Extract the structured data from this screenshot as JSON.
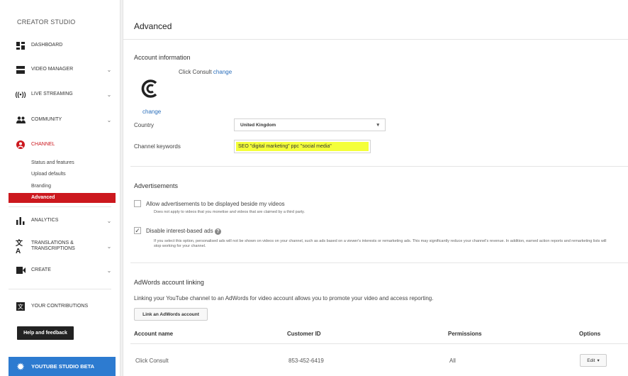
{
  "sidebar": {
    "brand": "CREATOR STUDIO",
    "items": [
      {
        "label": "DASHBOARD",
        "icon": "dashboard-icon"
      },
      {
        "label": "VIDEO MANAGER",
        "icon": "video-manager-icon"
      },
      {
        "label": "LIVE STREAMING",
        "icon": "live-streaming-icon"
      },
      {
        "label": "COMMUNITY",
        "icon": "community-icon"
      },
      {
        "label": "CHANNEL",
        "icon": "channel-icon"
      },
      {
        "label": "ANALYTICS",
        "icon": "analytics-icon"
      },
      {
        "label": "TRANSLATIONS & TRANSCRIPTIONS",
        "icon": "translations-icon"
      },
      {
        "label": "CREATE",
        "icon": "create-icon"
      }
    ],
    "channel_sub": [
      "Status and features",
      "Upload defaults",
      "Branding",
      "Advanced"
    ],
    "contributions": "YOUR CONTRIBUTIONS",
    "help": "Help and feedback",
    "beta": "YOUTUBE STUDIO BETA"
  },
  "main": {
    "title": "Advanced",
    "account": {
      "heading": "Account information",
      "name": "Click Consult",
      "change": "change",
      "change_logo": "change",
      "country_label": "Country",
      "country_value": "United Kingdom",
      "keywords_label": "Channel keywords",
      "keywords_value": "SEO \"digital marketing\" ppc \"social media\""
    },
    "ads": {
      "heading": "Advertisements",
      "allow_label": "Allow advertisements to be displayed beside my videos",
      "allow_checked": false,
      "allow_note": "Does not apply to videos that you monetise and videos that are claimed by a third party.",
      "disable_label": "Disable interest-based ads",
      "disable_checked": true,
      "disable_note": "If you select this option, personalised ads will not be shown on videos on your channel, such as ads based on a viewer's interests or remarketing ads. This may significantly reduce your channel's revenue. In addition, earned action reports and remarketing lists will stop working for your channel."
    },
    "adwords": {
      "heading": "AdWords account linking",
      "desc": "Linking your YouTube channel to an AdWords for video account allows you to promote your video and access reporting.",
      "button": "Link an AdWords account",
      "columns": [
        "Account name",
        "Customer ID",
        "Permissions",
        "Options"
      ],
      "row": {
        "name": "Click Consult",
        "id": "853-452-6419",
        "perm": "All",
        "edit": "Edit"
      }
    }
  },
  "colors": {
    "accent": "#cc181e",
    "beta": "#2d7bd0",
    "highlight": "#f4ff3a",
    "link": "#2a6ebb"
  }
}
